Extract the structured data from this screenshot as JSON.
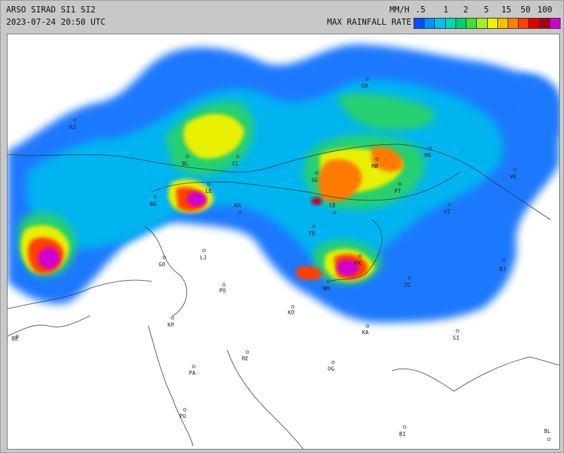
{
  "header": {
    "title": "ARSO SIRAD SI1 SI2",
    "timestamp": "2023-07-24 20:50 UTC",
    "unit": "MM/H",
    "caption": "MAX RAINFALL RATE"
  },
  "legend": {
    "values": [
      ".5",
      "1",
      "2",
      "5",
      "15",
      "50",
      "100"
    ],
    "colors": [
      "#0050ff",
      "#0090ff",
      "#00c0f0",
      "#00d8b0",
      "#00d070",
      "#40e030",
      "#a0f020",
      "#f0f000",
      "#ffc000",
      "#ff8000",
      "#ff4000",
      "#e00000",
      "#a80018",
      "#d000d0"
    ]
  },
  "cities": [
    {
      "code": "KZ"
    },
    {
      "code": "BL"
    },
    {
      "code": "CL"
    },
    {
      "code": "GR"
    },
    {
      "code": "MB"
    },
    {
      "code": "MS"
    },
    {
      "code": "SG"
    },
    {
      "code": "VK"
    },
    {
      "code": "LE"
    },
    {
      "code": "BG"
    },
    {
      "code": "KR"
    },
    {
      "code": "CE"
    },
    {
      "code": "PT"
    },
    {
      "code": "VZ"
    },
    {
      "code": "TB"
    },
    {
      "code": "KK"
    },
    {
      "code": "GO"
    },
    {
      "code": "LJ"
    },
    {
      "code": "NM"
    },
    {
      "code": "ZG"
    },
    {
      "code": "BJ"
    },
    {
      "code": "PO"
    },
    {
      "code": "KO"
    },
    {
      "code": "KP"
    },
    {
      "code": "KA"
    },
    {
      "code": "SI"
    },
    {
      "code": "BE"
    },
    {
      "code": "RE"
    },
    {
      "code": "OG"
    },
    {
      "code": "PA"
    },
    {
      "code": "PU"
    },
    {
      "code": "BI"
    },
    {
      "code": "BL"
    }
  ]
}
